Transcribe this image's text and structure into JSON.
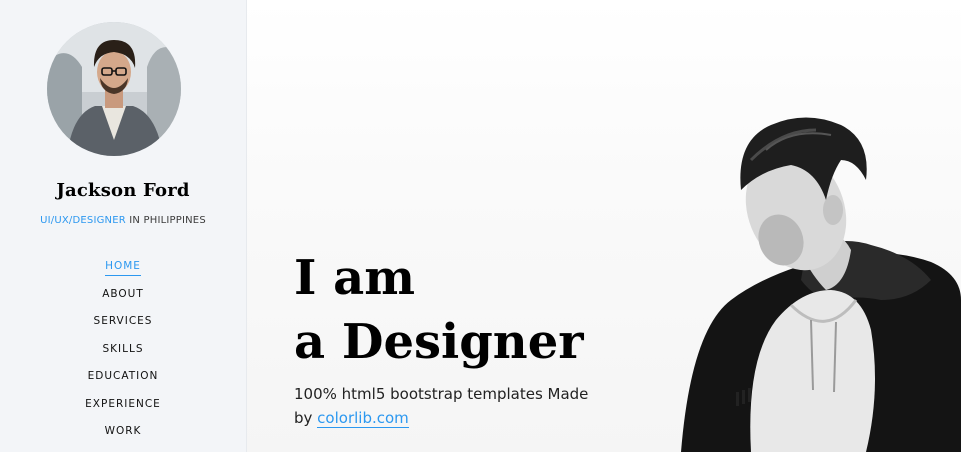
{
  "sidebar": {
    "name": "Jackson Ford",
    "position_role": "UI/UX/DESIGNER",
    "position_location": " IN PHILIPPINES",
    "nav": [
      {
        "label": "HOME",
        "active": true
      },
      {
        "label": "ABOUT",
        "active": false
      },
      {
        "label": "SERVICES",
        "active": false
      },
      {
        "label": "SKILLS",
        "active": false
      },
      {
        "label": "EDUCATION",
        "active": false
      },
      {
        "label": "EXPERIENCE",
        "active": false
      },
      {
        "label": "WORK",
        "active": false
      }
    ]
  },
  "hero": {
    "line1": "I am",
    "line2": "a Designer",
    "sub_text": "100% html5 bootstrap templates Made by ",
    "link_text": "colorlib.com"
  },
  "colors": {
    "accent": "#2c98f0",
    "sidebar_bg": "#f3f5f8",
    "text": "#000000"
  }
}
